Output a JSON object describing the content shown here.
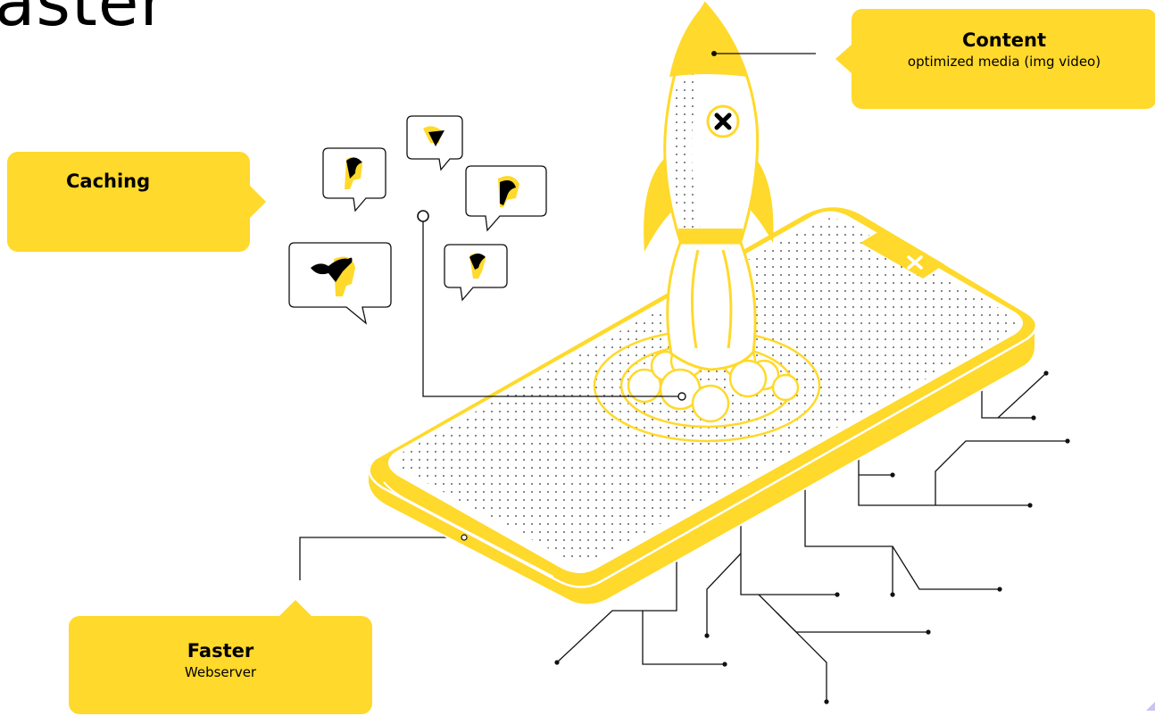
{
  "heading": {
    "text": "aster"
  },
  "callouts": {
    "content": {
      "title": "Content",
      "subtitle": "optimized media (img video)"
    },
    "caching": {
      "title": "Caching"
    },
    "faster": {
      "title": "Faster",
      "subtitle": "Webserver"
    }
  },
  "colors": {
    "accent_yellow": "#FFD92B",
    "line": "#111111",
    "background": "#FFFFFF"
  },
  "icons": {
    "rocket": "rocket-icon",
    "phone": "smartphone-icon",
    "chat_avatars": [
      "person-chat-bubble-icon",
      "person-chat-bubble-icon",
      "person-chat-bubble-icon",
      "person-chat-bubble-icon",
      "person-chat-bubble-icon"
    ]
  }
}
